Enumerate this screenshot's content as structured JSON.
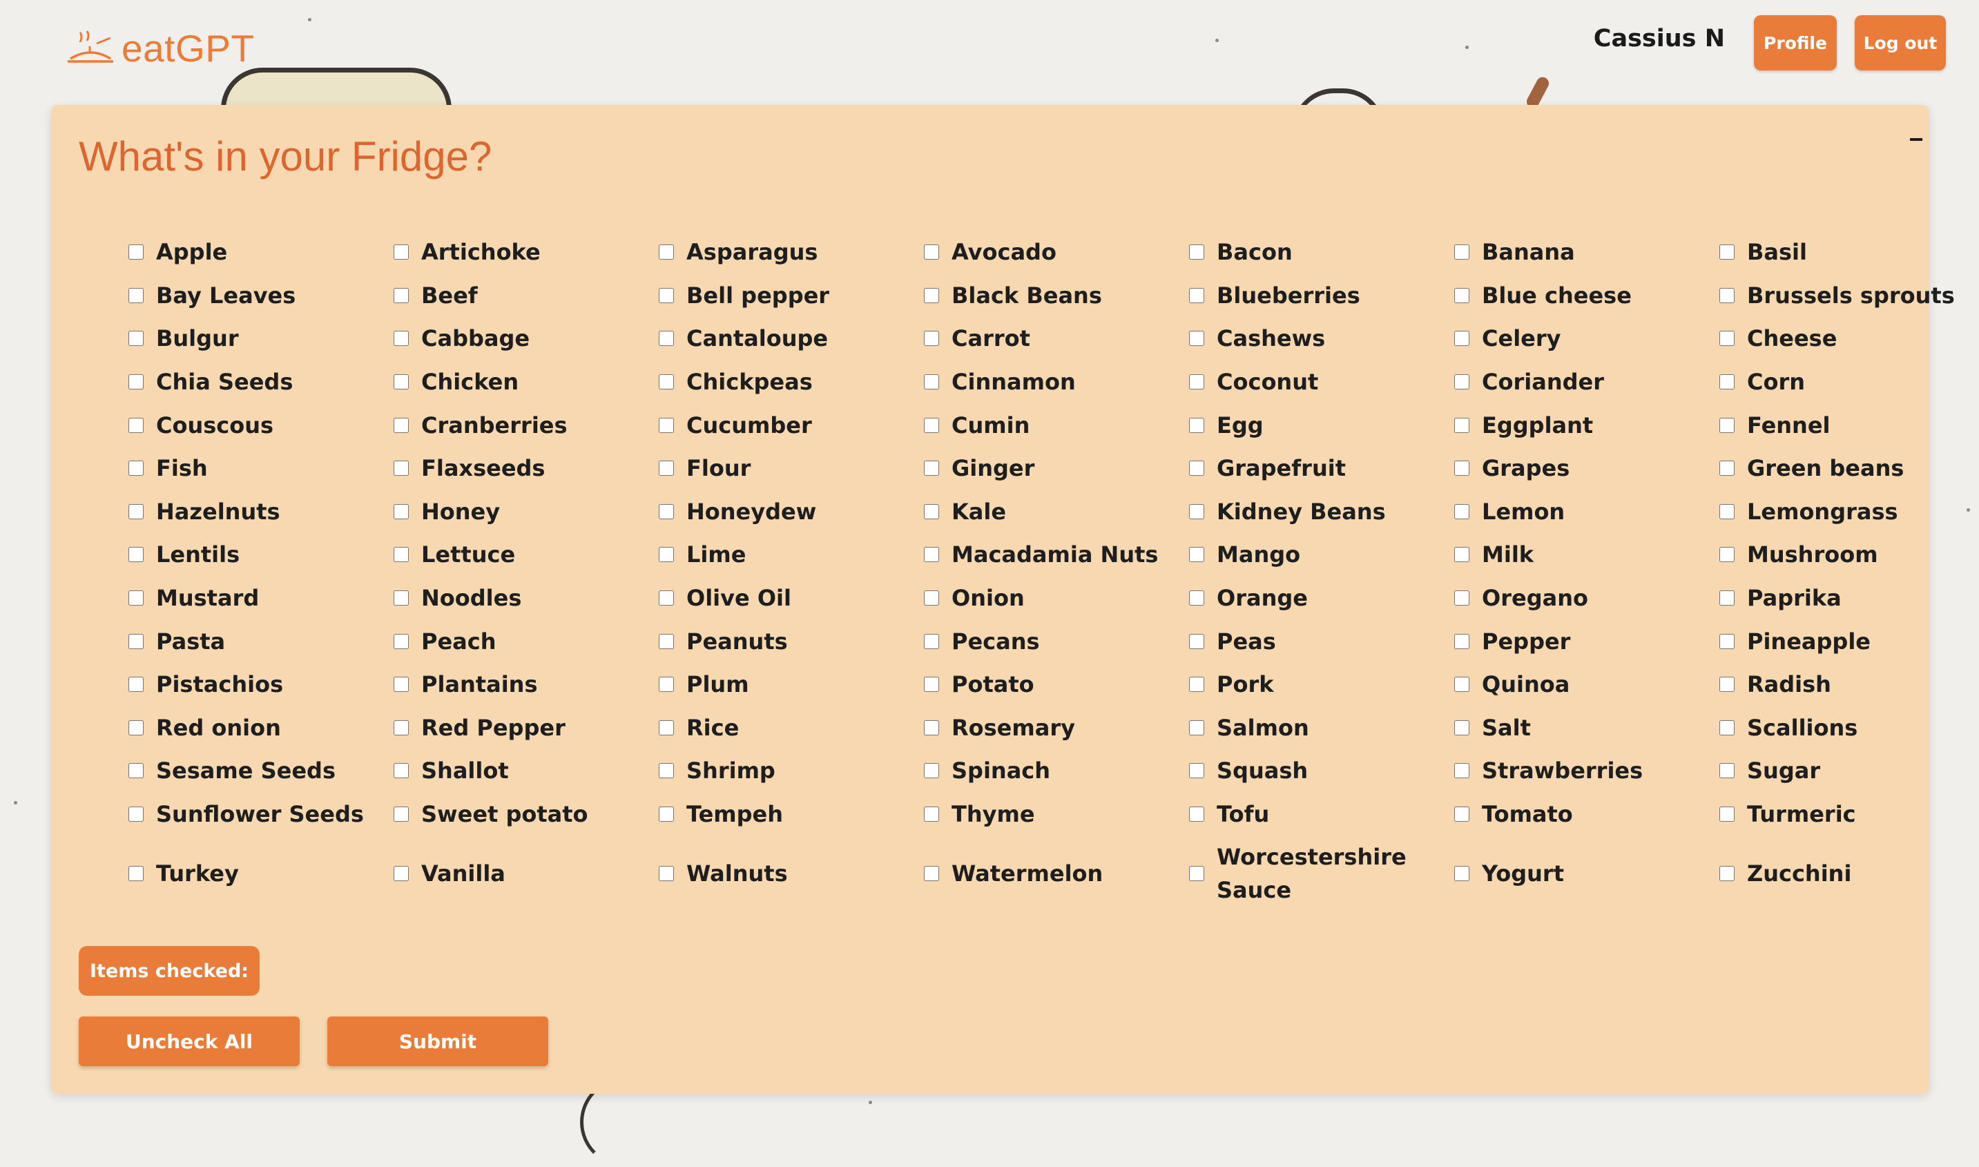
{
  "header": {
    "app_name": "eatGPT",
    "logo_icon": "serving-dish-icon",
    "user_name": "Cassius N",
    "profile_label": "Profile",
    "logout_label": "Log out"
  },
  "panel": {
    "title": "What's in your Fridge?",
    "minimize_icon": "minimize-icon",
    "ingredients": [
      "Apple",
      "Artichoke",
      "Asparagus",
      "Avocado",
      "Bacon",
      "Banana",
      "Basil",
      "Bay Leaves",
      "Beef",
      "Bell pepper",
      "Black Beans",
      "Blueberries",
      "Blue cheese",
      "Brussels sprouts",
      "Bulgur",
      "Cabbage",
      "Cantaloupe",
      "Carrot",
      "Cashews",
      "Celery",
      "Cheese",
      "Chia Seeds",
      "Chicken",
      "Chickpeas",
      "Cinnamon",
      "Coconut",
      "Coriander",
      "Corn",
      "Couscous",
      "Cranberries",
      "Cucumber",
      "Cumin",
      "Egg",
      "Eggplant",
      "Fennel",
      "Fish",
      "Flaxseeds",
      "Flour",
      "Ginger",
      "Grapefruit",
      "Grapes",
      "Green beans",
      "Hazelnuts",
      "Honey",
      "Honeydew",
      "Kale",
      "Kidney Beans",
      "Lemon",
      "Lemongrass",
      "Lentils",
      "Lettuce",
      "Lime",
      "Macadamia Nuts",
      "Mango",
      "Milk",
      "Mushroom",
      "Mustard",
      "Noodles",
      "Olive Oil",
      "Onion",
      "Orange",
      "Oregano",
      "Paprika",
      "Pasta",
      "Peach",
      "Peanuts",
      "Pecans",
      "Peas",
      "Pepper",
      "Pineapple",
      "Pistachios",
      "Plantains",
      "Plum",
      "Potato",
      "Pork",
      "Quinoa",
      "Radish",
      "Red onion",
      "Red Pepper",
      "Rice",
      "Rosemary",
      "Salmon",
      "Salt",
      "Scallions",
      "Sesame Seeds",
      "Shallot",
      "Shrimp",
      "Spinach",
      "Squash",
      "Strawberries",
      "Sugar",
      "Sunflower Seeds",
      "Sweet potato",
      "Tempeh",
      "Thyme",
      "Tofu",
      "Tomato",
      "Turmeric",
      "Turkey",
      "Vanilla",
      "Walnuts",
      "Watermelon",
      "Worcestershire Sauce",
      "Yogurt",
      "Zucchini"
    ],
    "items_checked_label": "Items checked:",
    "uncheck_all_label": "Uncheck All",
    "submit_label": "Submit"
  },
  "colors": {
    "accent": "#ea7c3a",
    "panel_bg": "#f8d8b1",
    "title": "#dc6530",
    "page_bg": "#f1efec"
  }
}
